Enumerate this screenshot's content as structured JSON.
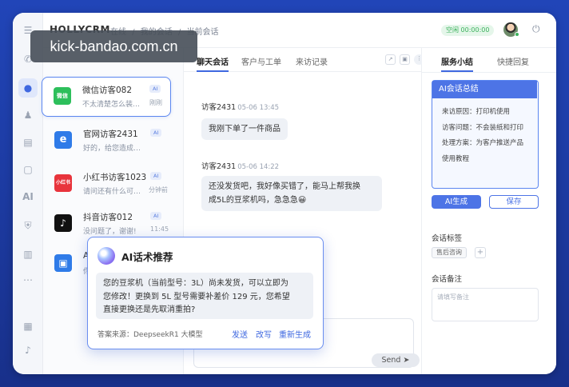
{
  "app": {
    "logo": "HOLLYCRM",
    "breadcrumbs": [
      "在线",
      "/",
      "我的会话",
      "/",
      "当前会话"
    ],
    "status": "空闲  00:00:00"
  },
  "watermark": "kick-bandao.com.cn",
  "conversations": [
    {
      "name": "微信访客082",
      "preview": "不太清楚怎么装…",
      "time": "刚刚",
      "badge": "AI",
      "logo": "微信",
      "color": "#2dbf5b"
    },
    {
      "name": "官网访客2431",
      "preview": "好的，给您造成…",
      "time": "",
      "badge": "AI",
      "logo": "e",
      "color": "#2f7be8"
    },
    {
      "name": "小红书访客1023",
      "preview": "请问还有什么可…",
      "time": "分钟前",
      "badge": "AI",
      "logo": "小红书",
      "color": "#e8343c"
    },
    {
      "name": "抖音访客012",
      "preview": "没问题了，谢谢!",
      "time": "11:45",
      "badge": "AI",
      "logo": "♪",
      "color": "#111111"
    },
    {
      "name": "A",
      "preview": "你",
      "time": "",
      "badge": "",
      "logo": "▣",
      "color": "#2f7be8"
    }
  ],
  "chat": {
    "tabs": [
      "聊天会话",
      "客户与工单",
      "来访记录"
    ],
    "messages": [
      {
        "sender": "访客2431",
        "time": "05-06 13:45",
        "text": "我刚下单了一件商品"
      },
      {
        "sender": "访客2431",
        "time": "05-06 14:22",
        "line1": "还没发货吧，我好像买错了，能马上帮我换",
        "line2": "成5L的豆浆机吗，急急急😀"
      }
    ],
    "send_label": "Send"
  },
  "right_panel": {
    "tabs": [
      "服务小结",
      "快捷回复"
    ],
    "summary_title": "AI会话总结",
    "summary_lines": [
      "来访原因：打印机使用",
      "访客问题：不会装纸和打印",
      "处理方案：为客户推送产品",
      "使用教程"
    ],
    "ai_generate": "AI生成",
    "save": "保存",
    "tags_label": "会话标签",
    "tag": "售后咨询",
    "tag_add": "+",
    "notes_label": "会话备注",
    "notes_placeholder": "请填写备注"
  },
  "ai_popup": {
    "title": "AI话术推荐",
    "line1": "您的豆浆机（当前型号：3L）尚未发货，可以立即为",
    "line2": "您修改！更换到 5L 型号需要补差价 129 元，您希望",
    "line3": "直接更换还是先取消重拍?",
    "source": "答案来源：DeepseekR1 大模型",
    "actions": [
      "发送",
      "改写",
      "重新生成"
    ]
  }
}
